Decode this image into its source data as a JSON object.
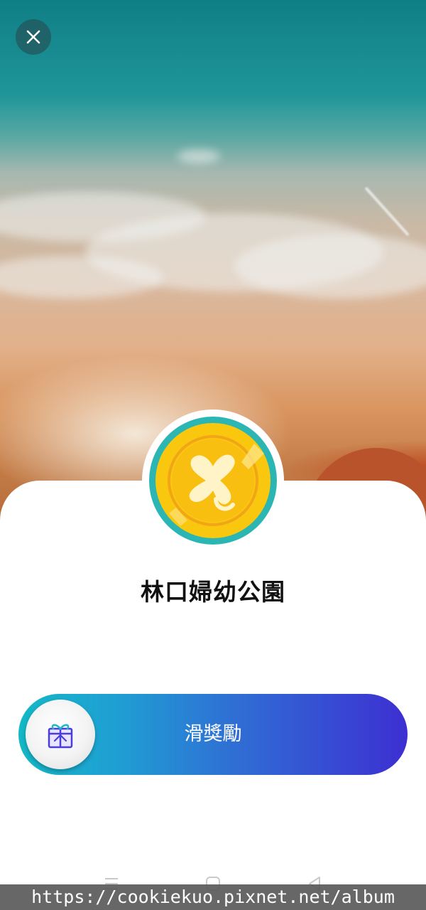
{
  "header": {
    "close_icon": "close-icon"
  },
  "coin": {
    "icon": "coin-logo-icon",
    "colors": {
      "ring": "#27b5b5",
      "gold": "#f9c80e",
      "gold_dark": "#f2a516",
      "mark": "#fff1c2"
    }
  },
  "place": {
    "name": "林口婦幼公園"
  },
  "slider": {
    "label": "滑獎勵",
    "handle_icon": "gift-icon",
    "colors": {
      "start": "#14b8c6",
      "end": "#3d2fd2"
    }
  },
  "nav": {
    "menu_icon": "menu-icon",
    "home_icon": "home-icon",
    "back_icon": "back-icon"
  },
  "watermark": {
    "text": "https://cookiekuo.pixnet.net/album"
  }
}
